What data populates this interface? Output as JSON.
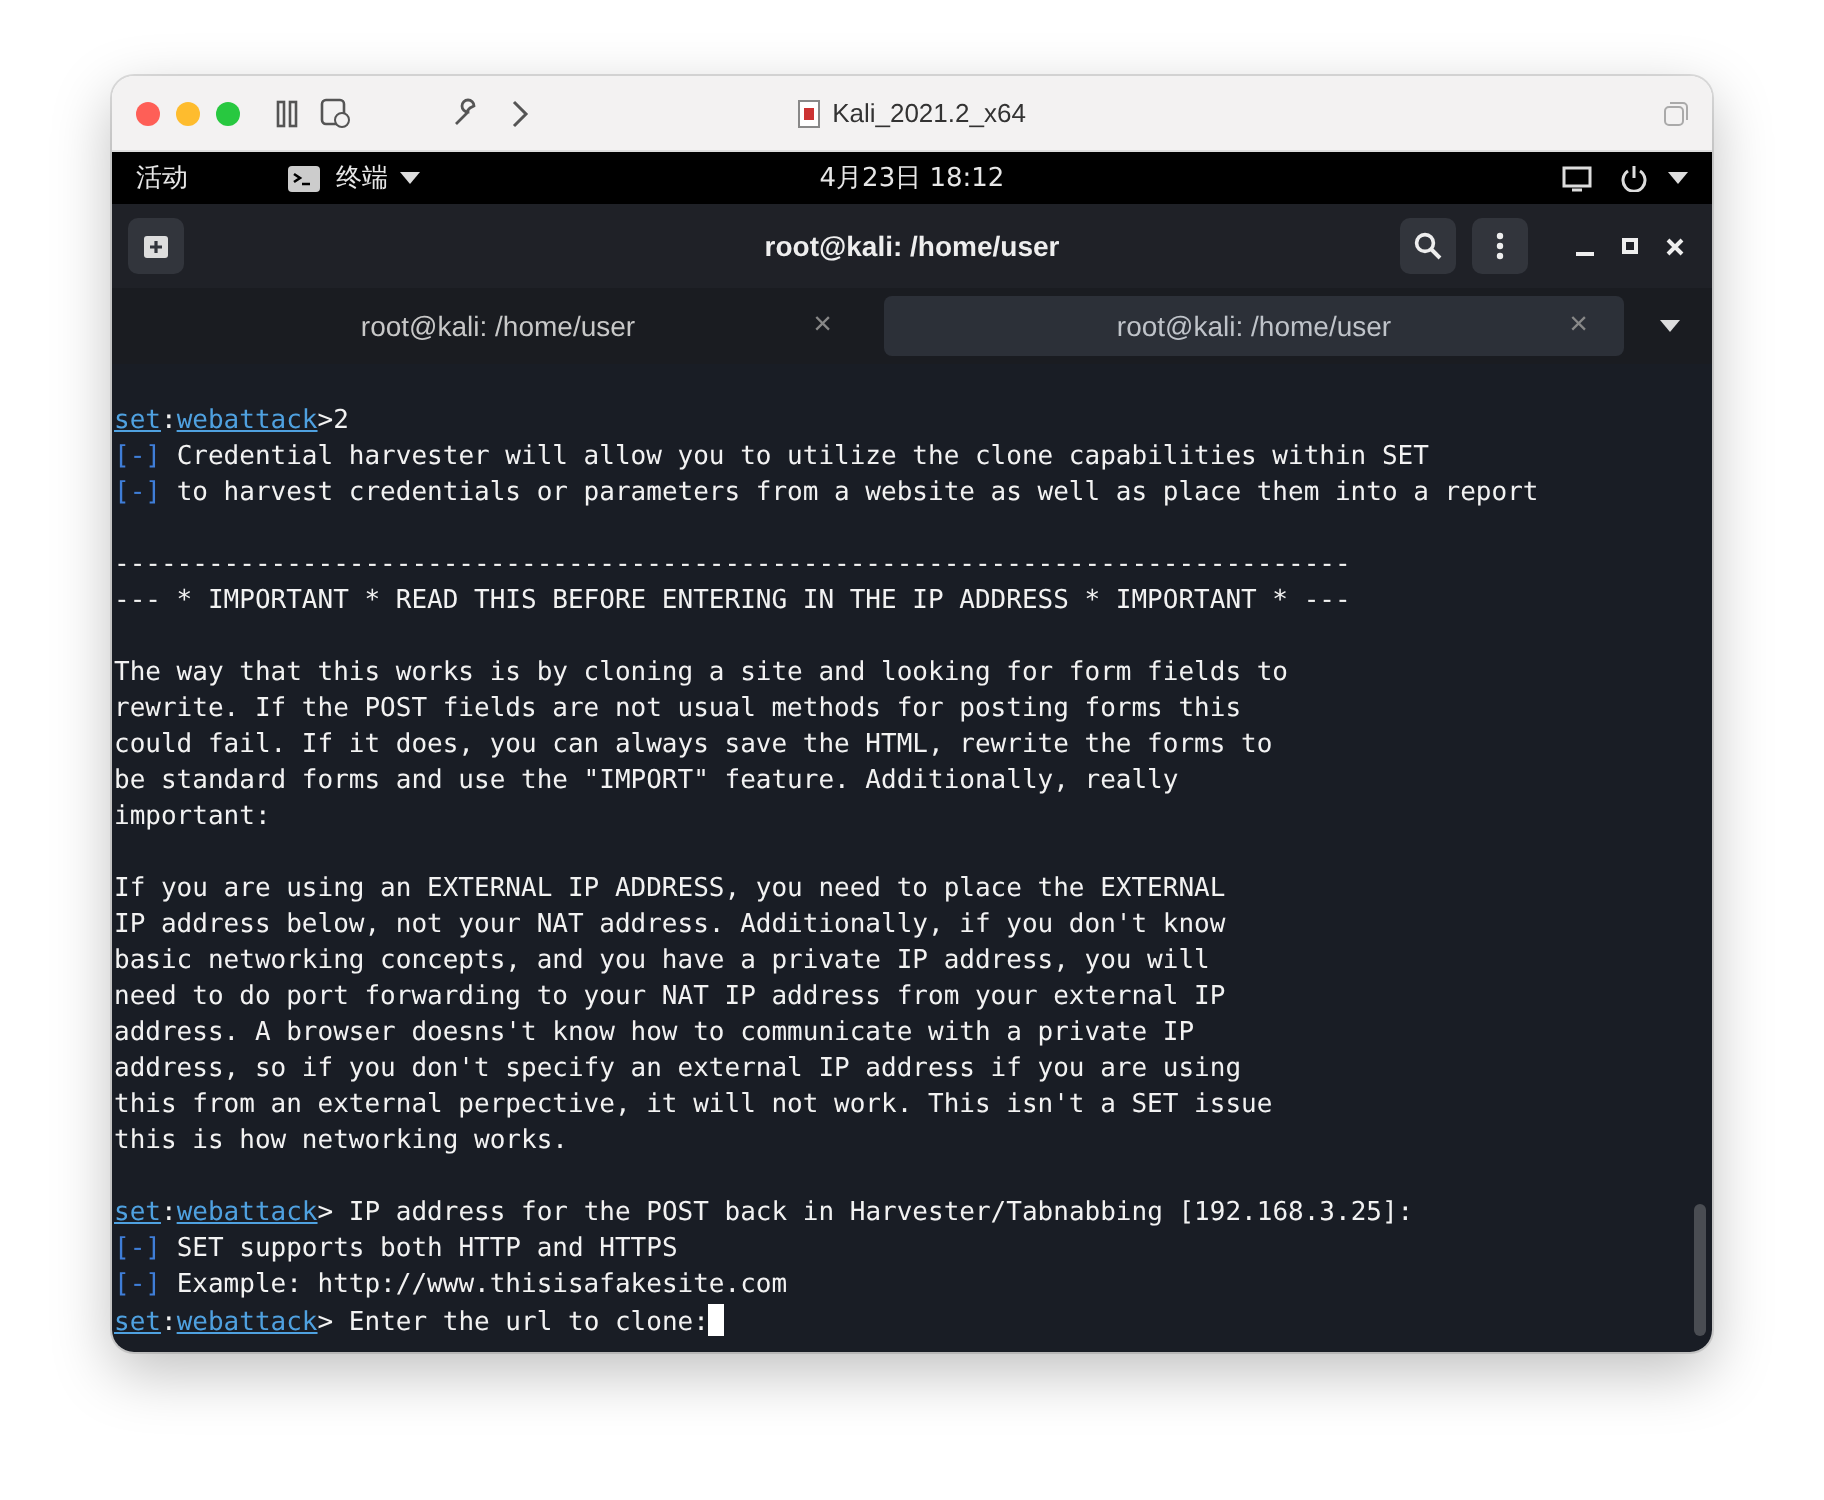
{
  "host_window": {
    "title": "Kali_2021.2_x64"
  },
  "top_bar": {
    "activities": "活动",
    "app": "终端",
    "clock": "4月23日 18:12"
  },
  "terminal_header": {
    "title": "root@kali: /home/user"
  },
  "tabs": [
    {
      "label": "root@kali: /home/user",
      "close": "×",
      "selected": false
    },
    {
      "label": "root@kali: /home/user",
      "close": "×",
      "selected": true
    }
  ],
  "lines": [
    {
      "kind": "prompt",
      "host": "set",
      "sep": ":",
      "module": "webattack",
      "text": ">2"
    },
    {
      "kind": "info",
      "marker": "[-]",
      "text": "Credential harvester will allow you to utilize the clone capabilities within SET"
    },
    {
      "kind": "info",
      "marker": "[-]",
      "text": "to harvest credentials or parameters from a website as well as place them into a report"
    },
    {
      "kind": "blank"
    },
    {
      "kind": "plain",
      "text": "-------------------------------------------------------------------------------"
    },
    {
      "kind": "plain",
      "text": "--- * IMPORTANT * READ THIS BEFORE ENTERING IN THE IP ADDRESS * IMPORTANT * ---"
    },
    {
      "kind": "blank"
    },
    {
      "kind": "plain",
      "text": "The way that this works is by cloning a site and looking for form fields to"
    },
    {
      "kind": "plain",
      "text": "rewrite. If the POST fields are not usual methods for posting forms this"
    },
    {
      "kind": "plain",
      "text": "could fail. If it does, you can always save the HTML, rewrite the forms to"
    },
    {
      "kind": "plain",
      "text": "be standard forms and use the \"IMPORT\" feature. Additionally, really"
    },
    {
      "kind": "plain",
      "text": "important:"
    },
    {
      "kind": "blank"
    },
    {
      "kind": "plain",
      "text": "If you are using an EXTERNAL IP ADDRESS, you need to place the EXTERNAL"
    },
    {
      "kind": "plain",
      "text": "IP address below, not your NAT address. Additionally, if you don't know"
    },
    {
      "kind": "plain",
      "text": "basic networking concepts, and you have a private IP address, you will"
    },
    {
      "kind": "plain",
      "text": "need to do port forwarding to your NAT IP address from your external IP"
    },
    {
      "kind": "plain",
      "text": "address. A browser doesns't know how to communicate with a private IP"
    },
    {
      "kind": "plain",
      "text": "address, so if you don't specify an external IP address if you are using"
    },
    {
      "kind": "plain",
      "text": "this from an external perpective, it will not work. This isn't a SET issue"
    },
    {
      "kind": "plain",
      "text": "this is how networking works."
    },
    {
      "kind": "blank"
    },
    {
      "kind": "prompt",
      "host": "set",
      "sep": ":",
      "module": "webattack",
      "text": "> IP address for the POST back in Harvester/Tabnabbing [192.168.3.25]:"
    },
    {
      "kind": "info",
      "marker": "[-]",
      "text": "SET supports both HTTP and HTTPS"
    },
    {
      "kind": "info",
      "marker": "[-]",
      "text": "Example: http://www.thisisafakesite.com"
    },
    {
      "kind": "prompt",
      "host": "set",
      "sep": ":",
      "module": "webattack",
      "text": "> Enter the url to clone:",
      "cursor": true
    }
  ]
}
